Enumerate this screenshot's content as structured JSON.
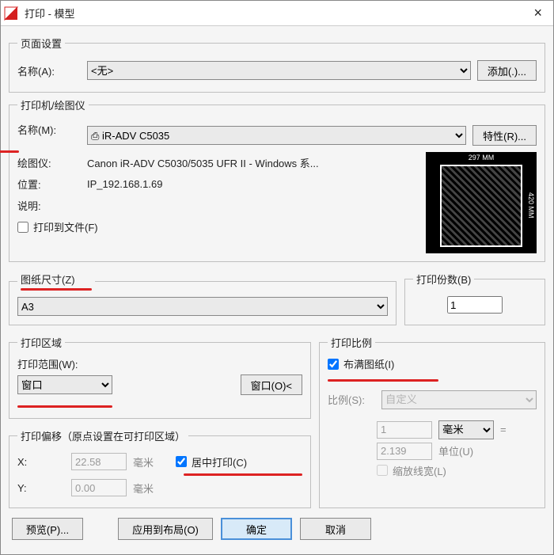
{
  "title": "打印 - 模型",
  "pageSetup": {
    "legend": "页面设置",
    "nameLabel": "名称(A):",
    "nameValue": "<无>",
    "addBtn": "添加(.)..."
  },
  "printer": {
    "legend": "打印机/绘图仪",
    "nameLabel": "名称(M):",
    "nameValue": "⎙ iR-ADV C5035",
    "propsBtn": "特性(R)...",
    "plotterLabel": "绘图仪:",
    "plotterValue": "Canon iR-ADV C5030/5035 UFR II - Windows 系...",
    "locationLabel": "位置:",
    "locationValue": "IP_192.168.1.69",
    "descLabel": "说明:",
    "plotToFile": "打印到文件(F)",
    "preview": {
      "top": "297 MM",
      "right": "420 MM"
    }
  },
  "paperSize": {
    "legend": "图纸尺寸(Z)",
    "value": "A3"
  },
  "copies": {
    "legend": "打印份数(B)",
    "value": "1"
  },
  "plotArea": {
    "legend": "打印区域",
    "rangeLabel": "打印范围(W):",
    "rangeValue": "窗口",
    "windowBtn": "窗口(O)<"
  },
  "offset": {
    "legend": "打印偏移（原点设置在可打印区域）",
    "xLabel": "X:",
    "xValue": "22.58",
    "xUnit": "毫米",
    "yLabel": "Y:",
    "yValue": "0.00",
    "yUnit": "毫米",
    "center": "居中打印(C)"
  },
  "scale": {
    "legend": "打印比例",
    "fit": "布满图纸(I)",
    "ratioLabel": "比例(S):",
    "ratioValue": "自定义",
    "val1": "1",
    "unit1": "毫米",
    "val2": "2.139",
    "unit2": "单位(U)",
    "scaleLW": "缩放线宽(L)"
  },
  "footer": {
    "preview": "预览(P)...",
    "apply": "应用到布局(O)",
    "ok": "确定",
    "cancel": "取消"
  }
}
